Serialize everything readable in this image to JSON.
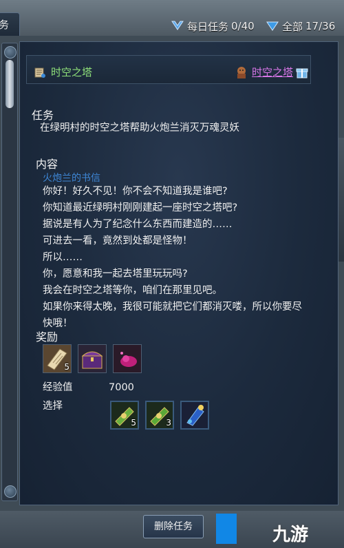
{
  "topbar": {
    "tab_stub": "务",
    "daily_label": "每日任务",
    "daily_count": "0/40",
    "total_label": "全部",
    "total_count": "17/36"
  },
  "header": {
    "quest_title": "时空之塔",
    "giver": "时空之塔"
  },
  "task": {
    "label": "任务",
    "description": "在绿明村的时空之塔帮助火炮兰消灭万魂灵妖"
  },
  "content": {
    "label": "内容",
    "letter_title": "火炮兰的书信",
    "lines": [
      "你好！好久不见！你不会不知道我是谁吧?",
      "你知道最近绿明村刚刚建起一座时空之塔吧?",
      "据说是有人为了纪念什么东西而建造的……",
      "可进去一看，竟然到处都是怪物！",
      "所以……",
      "你，愿意和我一起去塔里玩玩吗?",
      "我会在时空之塔等你，咱们在那里见吧。",
      "如果你来得太晚，我很可能就把它们都消灭喽，所以你要尽",
      "快哦！"
    ]
  },
  "rewards": {
    "label": "奖励",
    "items": [
      {
        "icon": "scroll-icon",
        "count": "5"
      },
      {
        "icon": "treasure-chest-icon",
        "count": ""
      },
      {
        "icon": "pink-gem-icon",
        "count": ""
      }
    ],
    "exp_label": "经验值",
    "exp_value": "7000",
    "choice_label": "选择",
    "choices": [
      {
        "icon": "green-talisman-icon",
        "count": "5"
      },
      {
        "icon": "green-talisman-icon",
        "count": "3"
      },
      {
        "icon": "blue-charm-icon",
        "count": ""
      }
    ]
  },
  "footer": {
    "delete_button": "删除任务",
    "watermark": "九游"
  },
  "colors": {
    "quest_title": "#8fe07a",
    "giver": "#d877e8",
    "letter_title": "#3e87d6"
  }
}
